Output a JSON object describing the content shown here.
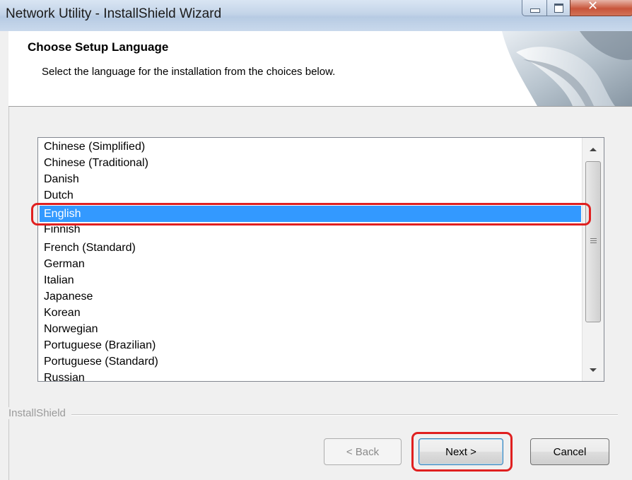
{
  "window": {
    "title": "Network Utility - InstallShield Wizard",
    "caption_close_glyph": "✕"
  },
  "header": {
    "title": "Choose Setup Language",
    "subtitle": "Select the language for the installation from the choices below."
  },
  "language_list": {
    "items": [
      "Chinese (Simplified)",
      "Chinese (Traditional)",
      "Danish",
      "Dutch",
      "English",
      "Finnish",
      "French (Standard)",
      "German",
      "Italian",
      "Japanese",
      "Korean",
      "Norwegian",
      "Portuguese (Brazilian)",
      "Portuguese (Standard)",
      "Russian"
    ],
    "selected": "English"
  },
  "footer": {
    "brand": "InstallShield"
  },
  "buttons": {
    "back": "< Back",
    "next": "Next >",
    "cancel": "Cancel"
  },
  "colors": {
    "selection": "#3399ff",
    "callout": "#e02020"
  }
}
